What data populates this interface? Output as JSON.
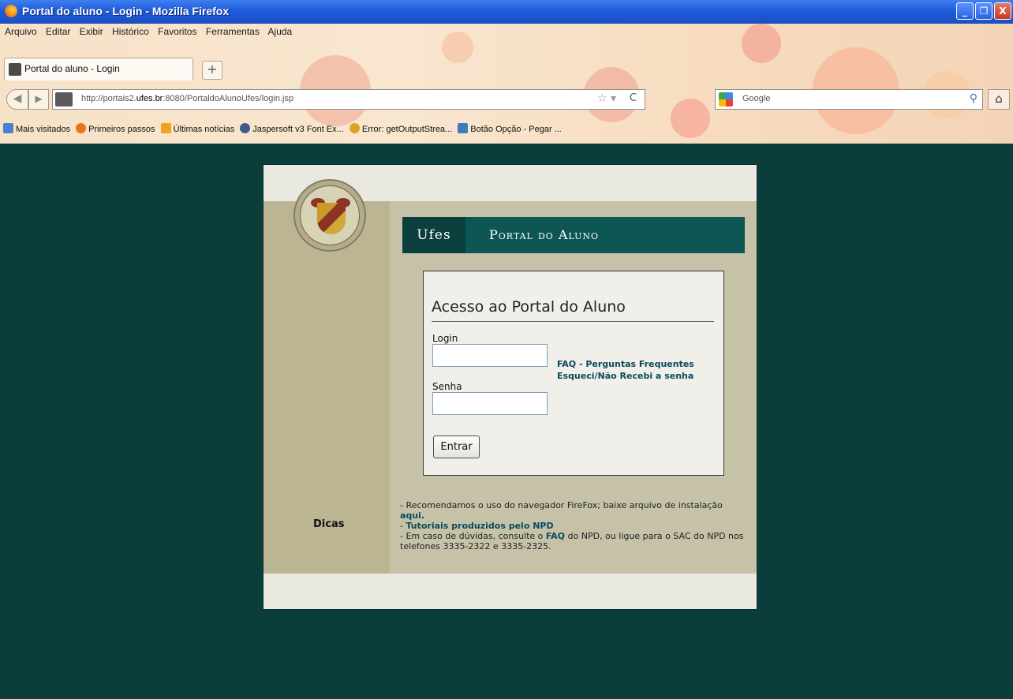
{
  "window": {
    "title": "Portal do aluno - Login - Mozilla Firefox",
    "controls": [
      "_",
      "❐",
      "X"
    ]
  },
  "menu": [
    "Arquivo",
    "Editar",
    "Exibir",
    "Histórico",
    "Favoritos",
    "Ferramentas",
    "Ajuda"
  ],
  "tab": {
    "label": "Portal do aluno - Login",
    "new_tab": "+"
  },
  "url": {
    "prefix": "http://portais2.",
    "host": "ufes.br",
    "suffix": ":8080/PortaldoAlunoUfes/login.jsp"
  },
  "search": {
    "placeholder": "Google"
  },
  "bookmarks": [
    {
      "label": "Mais visitados",
      "color": "#4a7fd0"
    },
    {
      "label": "Primeiros passos",
      "color": "#e8751a"
    },
    {
      "label": "Últimas notícias",
      "color": "#f3a21d"
    },
    {
      "label": "Jaspersoft v3 Font Ex...",
      "color": "#3a5d8a"
    },
    {
      "label": "Error: getOutputStrea...",
      "color": "#d9a424"
    },
    {
      "label": "Botão Opção - Pegar ...",
      "color": "#3f79c4"
    }
  ],
  "portal": {
    "brand": "Ufes",
    "portal_title": "Portal do Aluno",
    "login_title": "Acesso ao Portal do Aluno",
    "login_label": "Login",
    "senha_label": "Senha",
    "faq_link": "FAQ - Perguntas Frequentes",
    "forgot_link": "Esqueci/Não Recebi a senha",
    "submit": "Entrar",
    "tips_heading": "Dicas",
    "tips": {
      "t1": "- Recomendamos o uso do navegador FireFox; baixe arquivo de instalação ",
      "t1_link": "aqui.",
      "t2_prefix": "- ",
      "t2_link": "Tutoriais produzidos pelo NPD",
      "t3_a": "- Em caso de dúvidas, consulte o ",
      "t3_link": "FAQ",
      "t3_b": " do NPD, ou ligue para o SAC do NPD nos telefones 3335-2322 e 3335-2325."
    }
  },
  "colors": {
    "page_bg": "#0b3d3a",
    "banner": "#0d5654",
    "link": "#0a4a5c",
    "titlebar": "#1f5bd9"
  }
}
